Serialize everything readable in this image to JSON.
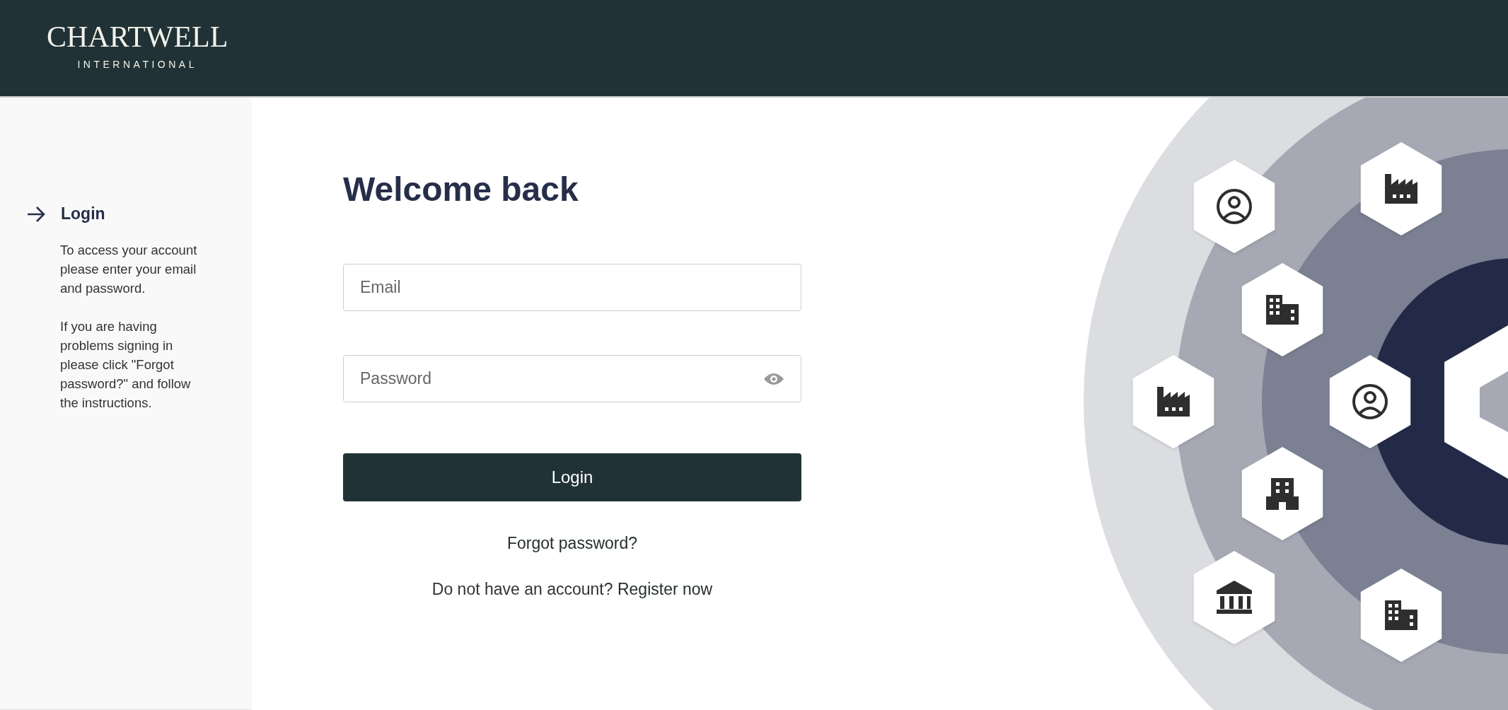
{
  "header": {
    "logo": {
      "name": "CHARTWELL",
      "tagline": "INTERNATIONAL"
    }
  },
  "sidebar": {
    "steps": [
      {
        "label": "Login",
        "selected": true
      }
    ],
    "paragraphs": [
      "To access your account please enter your email and password.",
      "If you are having problems signing in please click \"Forgot password?\" and follow the instructions."
    ]
  },
  "form": {
    "title": "Welcome back",
    "fields": [
      {
        "kind": "text",
        "placeholder": "Email"
      },
      {
        "kind": "password",
        "placeholder": "Password"
      }
    ],
    "submit": "Login",
    "forgot_link": "Forgot password?",
    "register_prompt": "Do not have an account?",
    "register_link": "Register now"
  }
}
